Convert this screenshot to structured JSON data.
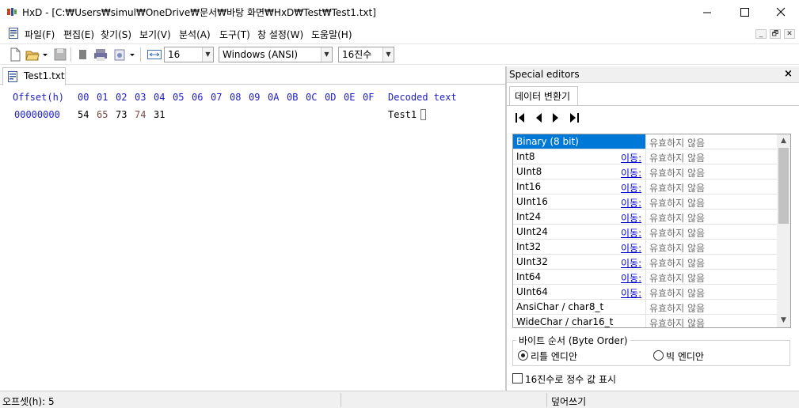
{
  "window": {
    "title": "HxD - [C:₩Users₩simul₩OneDrive₩문서₩바탕 화면₩HxD₩Test₩Test1.txt]",
    "app_icon": "hxd-app-icon",
    "controls": [
      "minimize-icon",
      "maximize-icon",
      "close-icon"
    ]
  },
  "menu": {
    "items": [
      "파일(F)",
      "편집(E)",
      "찾기(S)",
      "보기(V)",
      "분석(A)",
      "도구(T)",
      "창 설정(W)",
      "도움말(H)"
    ],
    "mdi_controls": [
      "_",
      "🗗",
      "✕"
    ]
  },
  "toolbar": {
    "bytes_per_row": "16",
    "charset": "Windows (ANSI)",
    "number_base": "16진수"
  },
  "document": {
    "tab_label": "Test1.txt",
    "header": {
      "offset_label": "Offset(h)",
      "columns": [
        "00",
        "01",
        "02",
        "03",
        "04",
        "05",
        "06",
        "07",
        "08",
        "09",
        "0A",
        "0B",
        "0C",
        "0D",
        "0E",
        "0F"
      ],
      "decoded_label": "Decoded text"
    },
    "rows": [
      {
        "offset": "00000000",
        "bytes": [
          "54",
          "65",
          "73",
          "74",
          "31"
        ],
        "decoded": "Test1"
      }
    ]
  },
  "special_editors": {
    "title": "Special editors",
    "close": "×",
    "tab": "데이터 변환기",
    "types": [
      {
        "name": "Binary (8 bit)",
        "go": "",
        "value": "유효하지 않음"
      },
      {
        "name": "Int8",
        "go": "이동:",
        "value": "유효하지 않음"
      },
      {
        "name": "UInt8",
        "go": "이동:",
        "value": "유효하지 않음"
      },
      {
        "name": "Int16",
        "go": "이동:",
        "value": "유효하지 않음"
      },
      {
        "name": "UInt16",
        "go": "이동:",
        "value": "유효하지 않음"
      },
      {
        "name": "Int24",
        "go": "이동:",
        "value": "유효하지 않음"
      },
      {
        "name": "UInt24",
        "go": "이동:",
        "value": "유효하지 않음"
      },
      {
        "name": "Int32",
        "go": "이동:",
        "value": "유효하지 않음"
      },
      {
        "name": "UInt32",
        "go": "이동:",
        "value": "유효하지 않음"
      },
      {
        "name": "Int64",
        "go": "이동:",
        "value": "유효하지 않음"
      },
      {
        "name": "UInt64",
        "go": "이동:",
        "value": "유효하지 않음"
      },
      {
        "name": "AnsiChar / char8_t",
        "go": "",
        "value": "유효하지 않음"
      },
      {
        "name": "WideChar / char16_t",
        "go": "",
        "value": "유효하지 않음"
      }
    ],
    "byte_order": {
      "legend": "바이트 순서 (Byte Order)",
      "little_endian": "리틀 엔디안",
      "big_endian": "빅 엔디안",
      "selected": "little_endian"
    },
    "hex_integers_label": "16진수로 정수 값 표시",
    "hex_integers_checked": false
  },
  "status": {
    "offset": "오프셋(h): 5",
    "mode": "덮어쓰기"
  },
  "colors": {
    "header_text": "#2020c8",
    "selection": "#0078d7",
    "link": "#0000d0",
    "invalid_text": "#6e6e6e"
  }
}
